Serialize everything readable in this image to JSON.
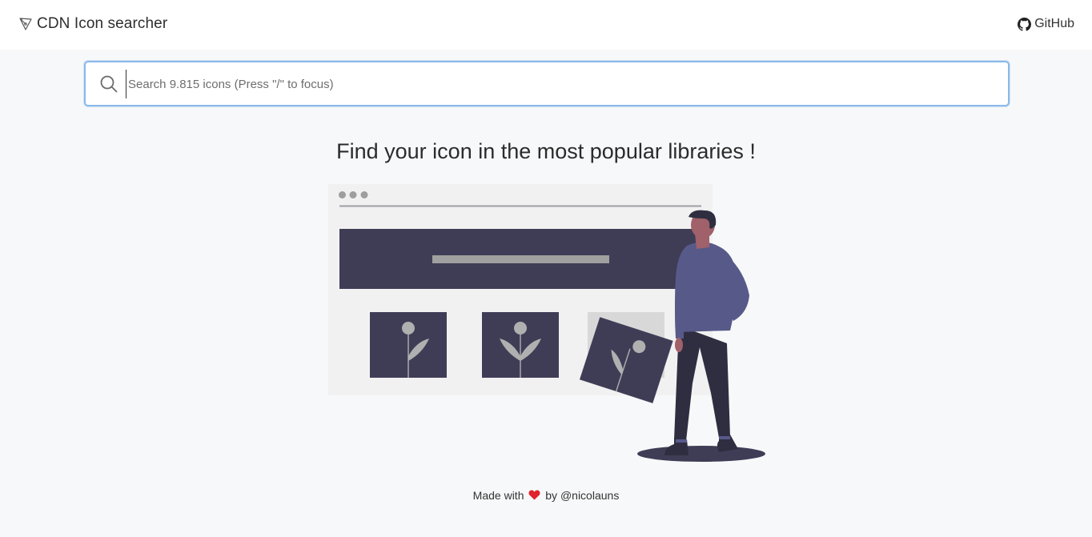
{
  "navbar": {
    "brand_icon": "vector-pen-icon",
    "brand_title": "CDN Icon searcher",
    "github_icon": "github-icon",
    "github_label": "GitHub"
  },
  "search": {
    "icon": "search-icon",
    "placeholder": "Search 9.815 icons (Press \"/\" to focus)",
    "value": "",
    "focus_color": "#8ab9ea"
  },
  "main": {
    "headline": "Find your icon in the most popular libraries !",
    "illustration": "person-browsing-icon-gallery-illustration"
  },
  "footer": {
    "prefix": "Made with",
    "heart_icon": "heart-icon",
    "heart_color": "#e0242b",
    "middle": "by",
    "author": "@nicolauns"
  },
  "colors": {
    "background": "#f7f8f9",
    "navbar": "#ffffff",
    "illustration_dark": "#3f3d56",
    "illustration_accent": "#575a89"
  }
}
